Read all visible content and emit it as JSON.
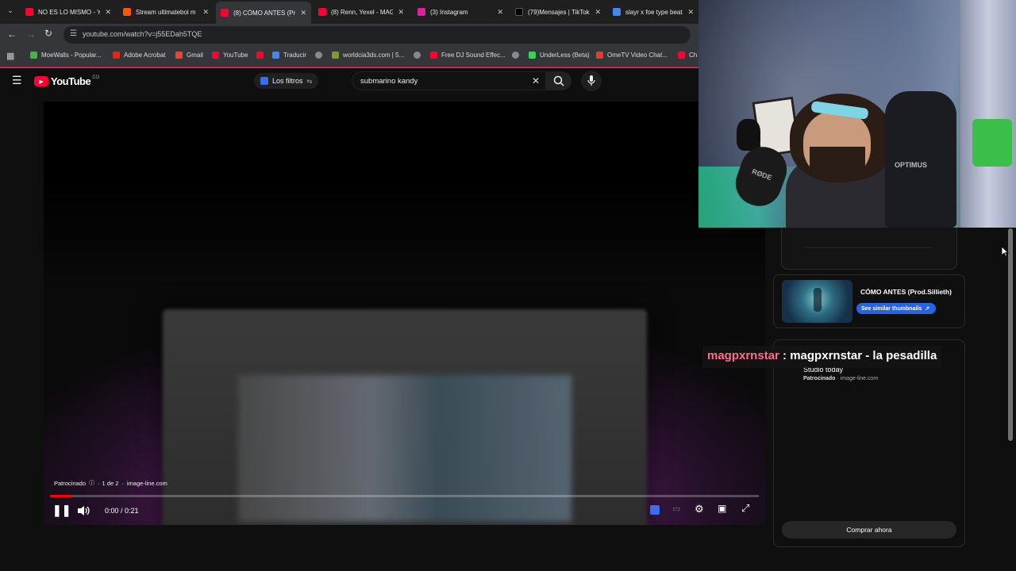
{
  "tabs": [
    {
      "title": "NO ES LO MISMO - Y",
      "color": "#ff0033"
    },
    {
      "title": "Stream ultimateboi m",
      "color": "#ff5500"
    },
    {
      "title": "(8) CÓMO ANTES (Pr",
      "color": "#ff0033"
    },
    {
      "title": "(8) Renn, Yexel - MAG",
      "color": "#ff0033"
    },
    {
      "title": "(3) Instagram",
      "color": "#d6249f"
    },
    {
      "title": "(79)Mensajes | TikTok",
      "color": "#111111"
    },
    {
      "title": "slayr x foe type beat",
      "color": "#4285f4"
    }
  ],
  "address": {
    "url": "youtube.com/watch?v=j55EDah5TQE"
  },
  "bookmarks": [
    "MoeWalls - Popular...",
    "Adobe Acrobat",
    "Gmail",
    "YouTube",
    "",
    "Traducir",
    "",
    "worldcia3ds.com | 5...",
    "",
    "Free DJ Sound Effec...",
    "",
    "UnderLess (Beta)",
    "OmeTV Video Chat...",
    "Ch"
  ],
  "youtube": {
    "logo": "YouTube",
    "country": "CO",
    "filters_label": "Los filtros",
    "search_value": "submarino kandy"
  },
  "player": {
    "sponsored": "Patrocinado",
    "ad_count": "1 de 2",
    "ad_domain": "image-line.com",
    "time": "0:00 / 0:21",
    "progress": 0.005
  },
  "sidebar": {
    "video_title": "CÓMO ANTES (Prod.Sillieth)",
    "similar_button": "See similar thumbnails",
    "ad_title": "Studio today",
    "ad_sponsored": "Patrocinado",
    "ad_domain": "image-line.com",
    "buy_button": "Comprar ahora"
  },
  "chat": {
    "user": "magpxrnstar",
    "separator": " : ",
    "message": "magpxrnstar - la pesadilla"
  },
  "webcam": {
    "mic_label": "RØDE",
    "chair_label": "OPTIMUS"
  }
}
